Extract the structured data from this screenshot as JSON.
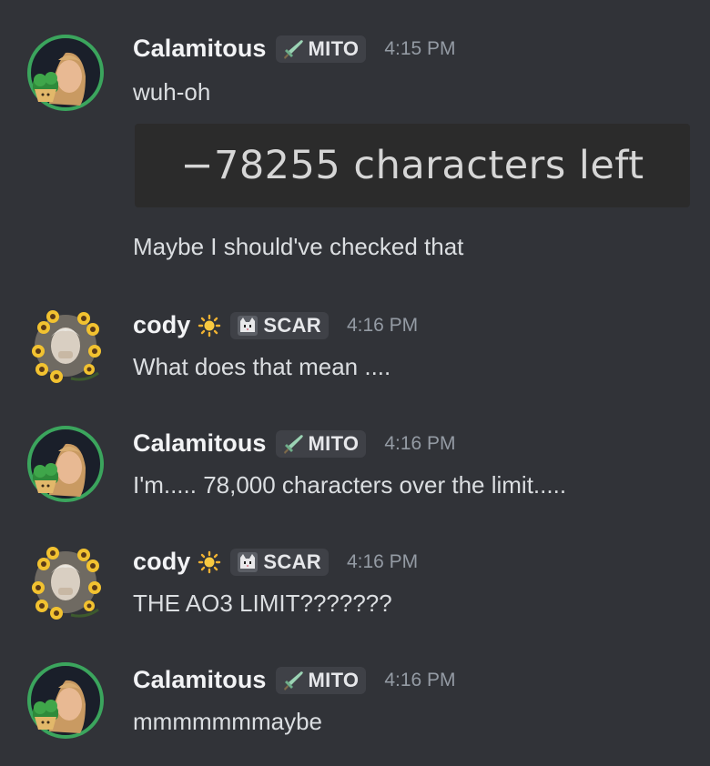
{
  "messages": [
    {
      "author": "Calamitous",
      "tag": "MITO",
      "tag_icon": "sword-icon",
      "time": "4:15 PM",
      "lines": [
        "wuh-oh"
      ],
      "attachment_text": "−78255 characters left",
      "followup": "Maybe I should've checked that"
    },
    {
      "author": "cody",
      "status_icon": "sun-icon",
      "tag": "SCAR",
      "tag_icon": "cat-icon",
      "time": "4:16 PM",
      "lines": [
        "What does that mean ...."
      ]
    },
    {
      "author": "Calamitous",
      "tag": "MITO",
      "tag_icon": "sword-icon",
      "time": "4:16 PM",
      "lines": [
        "I'm..... 78,000 characters over the limit....."
      ]
    },
    {
      "author": "cody",
      "status_icon": "sun-icon",
      "tag": "SCAR",
      "tag_icon": "cat-icon",
      "time": "4:16 PM",
      "lines": [
        "THE AO3 LIMIT???????"
      ]
    },
    {
      "author": "Calamitous",
      "tag": "MITO",
      "tag_icon": "sword-icon",
      "time": "4:16 PM",
      "lines": [
        "mmmmmmmaybe"
      ]
    }
  ],
  "colors": {
    "background": "#313338",
    "username": "#f2f3f5",
    "timestamp": "#949ba4",
    "message_text": "#dbdee1",
    "tag_background": "#3f4147",
    "avatar_ring": "#3ba55d"
  }
}
